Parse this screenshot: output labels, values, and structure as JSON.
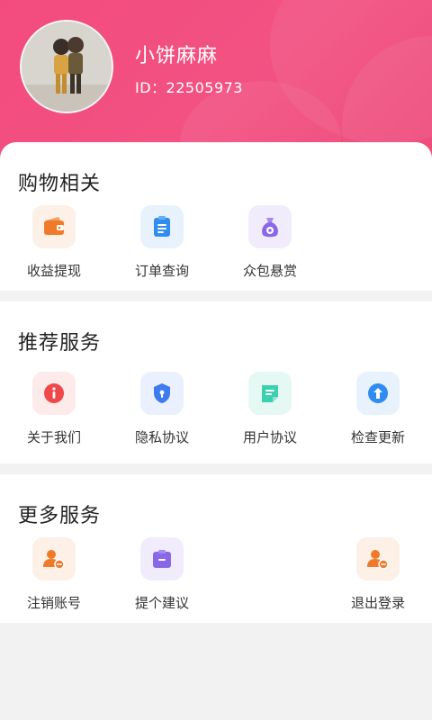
{
  "profile": {
    "name": "小饼麻麻",
    "id_text": "ID：22505973"
  },
  "sections": [
    {
      "title": "购物相关",
      "items": [
        {
          "label": "收益提现",
          "icon": "wallet-icon"
        },
        {
          "label": "订单查询",
          "icon": "clipboard-icon"
        },
        {
          "label": "众包悬赏",
          "icon": "money-bag-icon"
        }
      ]
    },
    {
      "title": "推荐服务",
      "items": [
        {
          "label": "关于我们",
          "icon": "info-icon"
        },
        {
          "label": "隐私协议",
          "icon": "shield-icon"
        },
        {
          "label": "用户协议",
          "icon": "document-icon"
        },
        {
          "label": "检查更新",
          "icon": "upload-arrow-icon"
        }
      ]
    },
    {
      "title": "更多服务",
      "items": [
        {
          "label": "注销账号",
          "icon": "user-remove-icon"
        },
        {
          "label": "提个建议",
          "icon": "suggestion-icon"
        },
        {
          "label": "退出登录",
          "icon": "logout-user-icon"
        }
      ]
    }
  ],
  "colors": {
    "header_pink": "#f34b7d",
    "orange": "#f07a2b",
    "blue": "#2f8cf0",
    "purple": "#8a67e6",
    "red": "#f04848",
    "teal": "#3dd0b0"
  }
}
